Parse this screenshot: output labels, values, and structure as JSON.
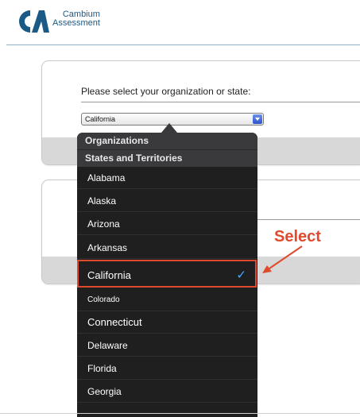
{
  "logo": {
    "line1": "Cambium",
    "line2": "Assessment"
  },
  "prompt": "Please select your organization or state:",
  "select": {
    "value": "California"
  },
  "dropdown": {
    "groups": [
      "Organizations",
      "States and Territories"
    ],
    "options": [
      {
        "label": "Alabama"
      },
      {
        "label": "Alaska"
      },
      {
        "label": "Arizona"
      },
      {
        "label": "Arkansas"
      },
      {
        "label": "California",
        "selected": true
      },
      {
        "label": "Colorado"
      },
      {
        "label": "Connecticut"
      },
      {
        "label": "Delaware"
      },
      {
        "label": "Florida"
      },
      {
        "label": "Georgia"
      }
    ],
    "check_glyph": "✓"
  },
  "annotation": {
    "label": "Select",
    "color": "#e04a2c"
  },
  "colors": {
    "brand": "#1b5a86",
    "check": "#4ea8ff",
    "popover": "#1f1f1f"
  }
}
